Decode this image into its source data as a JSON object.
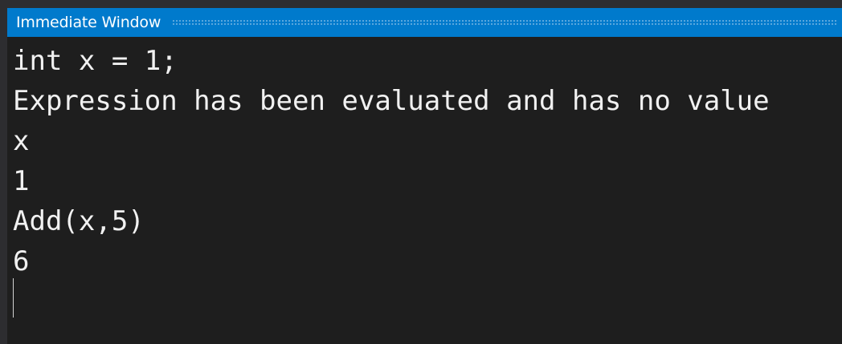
{
  "window": {
    "title": "Immediate Window"
  },
  "colors": {
    "title_bar": "#007acc",
    "background": "#1e1e1e",
    "text": "#f1f1f1"
  },
  "lines": [
    "int x = 1;",
    "Expression has been evaluated and has no value",
    "x",
    "1",
    "Add(x,5)",
    "6"
  ]
}
